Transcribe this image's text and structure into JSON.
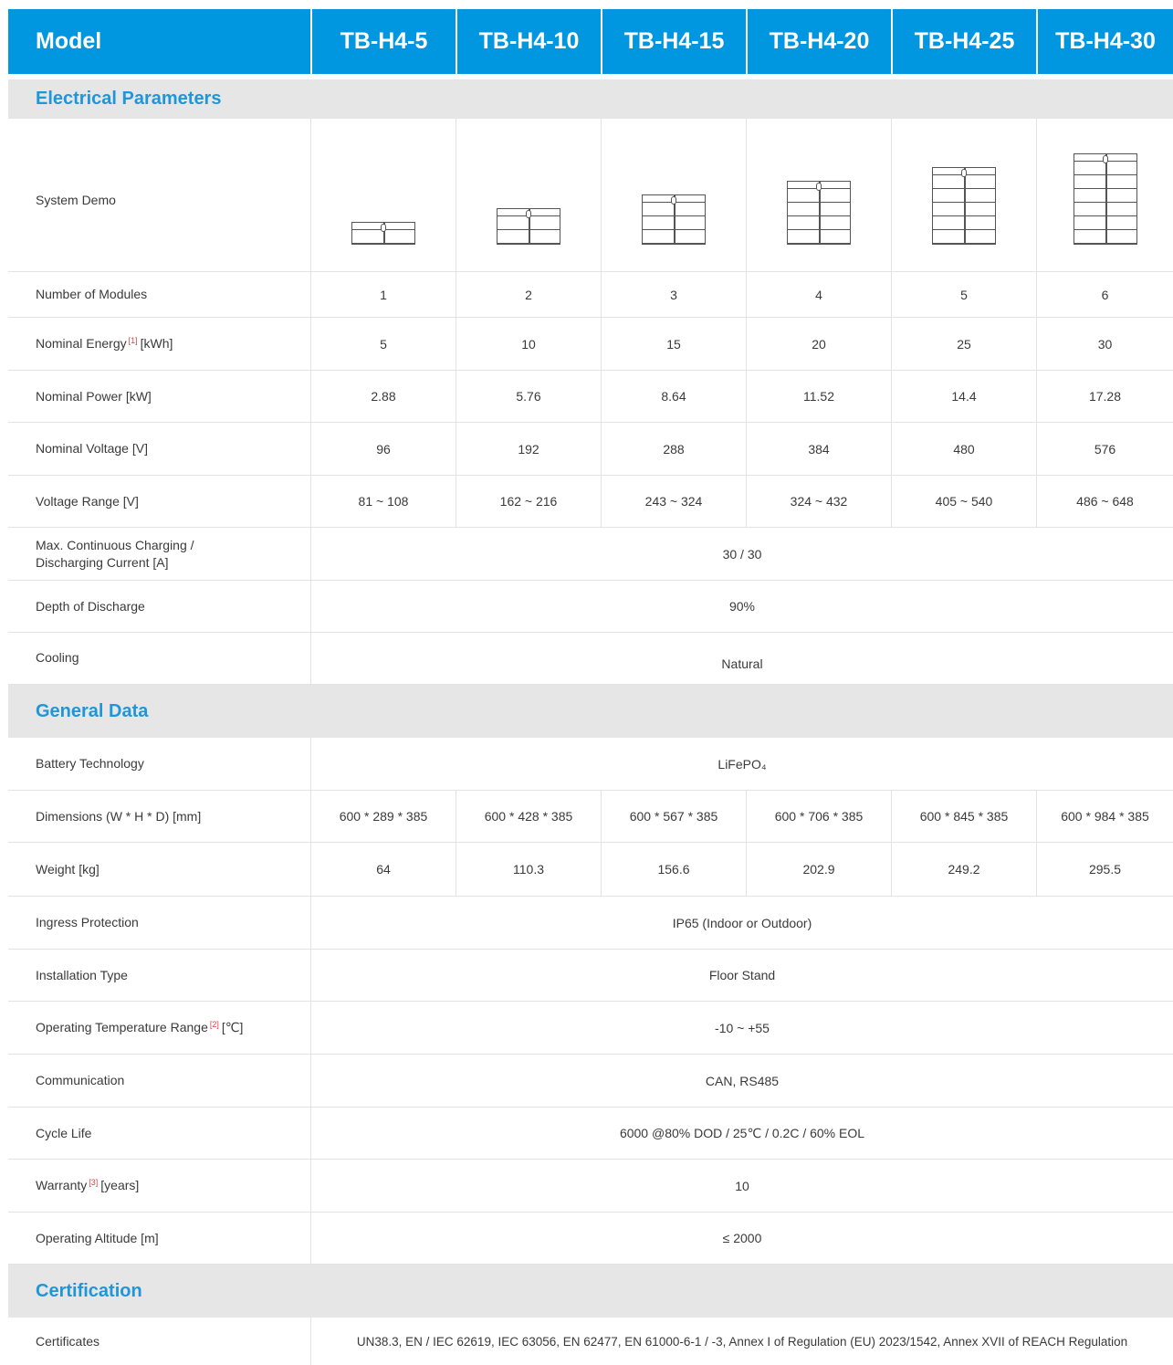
{
  "header": {
    "model_label": "Model",
    "models": [
      "TB-H4-5",
      "TB-H4-10",
      "TB-H4-15",
      "TB-H4-20",
      "TB-H4-25",
      "TB-H4-30"
    ]
  },
  "sections": {
    "electrical": "Electrical Parameters",
    "general": "General Data",
    "certification": "Certification"
  },
  "rows": {
    "system_demo": {
      "label": "System Demo",
      "modules_shown": [
        1,
        2,
        3,
        4,
        5,
        6
      ]
    },
    "modules": {
      "label": "Number of Modules",
      "values": [
        "1",
        "2",
        "3",
        "4",
        "5",
        "6"
      ]
    },
    "energy": {
      "label": "Nominal Energy",
      "note": "[1]",
      "unit": "[kWh]",
      "values": [
        "5",
        "10",
        "15",
        "20",
        "25",
        "30"
      ]
    },
    "power": {
      "label": "Nominal Power [kW]",
      "values": [
        "2.88",
        "5.76",
        "8.64",
        "11.52",
        "14.4",
        "17.28"
      ]
    },
    "voltage": {
      "label": "Nominal Voltage [V]",
      "values": [
        "96",
        "192",
        "288",
        "384",
        "480",
        "576"
      ]
    },
    "voltage_range": {
      "label": "Voltage Range [V]",
      "values": [
        "81 ~ 108",
        "162 ~ 216",
        "243 ~ 324",
        "324 ~ 432",
        "405 ~ 540",
        "486 ~ 648"
      ]
    },
    "current": {
      "label_line1": "Max. Continuous Charging /",
      "label_line2": "Discharging Current [A]",
      "value": "30 / 30"
    },
    "dod": {
      "label": "Depth of Discharge",
      "value": "90%"
    },
    "cooling": {
      "label": "Cooling",
      "value": "Natural"
    },
    "technology": {
      "label": "Battery Technology",
      "value": "LiFePO₄"
    },
    "dimensions": {
      "label": "Dimensions (W * H * D) [mm]",
      "values": [
        "600 * 289 * 385",
        "600 * 428 * 385",
        "600 * 567 * 385",
        "600 * 706 * 385",
        "600 * 845 * 385",
        "600 * 984 * 385"
      ]
    },
    "weight": {
      "label": "Weight [kg]",
      "values": [
        "64",
        "110.3",
        "156.6",
        "202.9",
        "249.2",
        "295.5"
      ]
    },
    "ingress": {
      "label": "Ingress Protection",
      "value": "IP65 (Indoor or Outdoor)"
    },
    "installation": {
      "label": "Installation Type",
      "value": "Floor Stand"
    },
    "temperature": {
      "label": "Operating Temperature Range",
      "note": "[2]",
      "unit": "[℃]",
      "value": "-10 ~ +55"
    },
    "communication": {
      "label": "Communication",
      "value": "CAN, RS485"
    },
    "cycle_life": {
      "label": "Cycle Life",
      "value": "6000 @80% DOD / 25℃ / 0.2C / 60% EOL"
    },
    "warranty": {
      "label": "Warranty",
      "note": "[3]",
      "unit": "[years]",
      "value": "10"
    },
    "altitude": {
      "label": "Operating Altitude [m]",
      "value": "≤ 2000"
    },
    "certificates": {
      "label": "Certificates",
      "value": "UN38.3, EN / IEC 62619, IEC 63056, EN 62477, EN 61000-6-1 / -3, Annex I of Regulation (EU) 2023/1542,  Annex XVII of REACH Regulation"
    }
  },
  "colors": {
    "header_bg": "#0096e0",
    "section_text": "#1f96d8",
    "section_bg": "#e6e6e6",
    "note_red": "#e0404a"
  }
}
